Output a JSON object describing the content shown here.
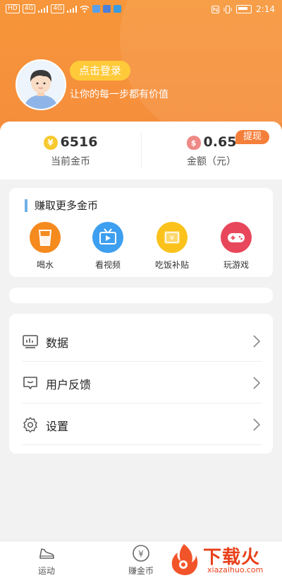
{
  "status_bar": {
    "left_chips": [
      "HD",
      "4G",
      "4G"
    ],
    "time": "2:14"
  },
  "profile": {
    "login_label": "点击登录",
    "slogan": "让你的每一步都有价值"
  },
  "stats": {
    "coins_value": "6516",
    "coins_label": "当前金币",
    "amount_value": "0.65",
    "amount_label": "金额（元）",
    "withdraw_label": "提现",
    "coin_symbol": "¥",
    "bag_symbol": "$"
  },
  "earn": {
    "title": "赚取更多金币",
    "tasks": [
      {
        "label": "喝水",
        "icon": "cup-icon",
        "color": "#f58a1f"
      },
      {
        "label": "看视频",
        "icon": "tv-icon",
        "color": "#3d9ff0"
      },
      {
        "label": "吃饭补贴",
        "icon": "meal-ticket-icon",
        "color": "#fbc21c"
      },
      {
        "label": "玩游戏",
        "icon": "gamepad-icon",
        "color": "#e8475b"
      }
    ]
  },
  "menu": {
    "items": [
      {
        "label": "数据",
        "icon": "chart-icon"
      },
      {
        "label": "用户反馈",
        "icon": "feedback-icon"
      },
      {
        "label": "设置",
        "icon": "gear-icon"
      }
    ]
  },
  "bottom_nav": {
    "items": [
      {
        "label": "运动",
        "icon": "sneaker-icon"
      },
      {
        "label": "赚金币",
        "icon": "yuan-coin-icon"
      }
    ]
  },
  "watermark": {
    "title": "下载火",
    "url": "xiazaihuo.com"
  },
  "colors": {
    "header": "#f7963a",
    "login_button": "#ffca3a",
    "withdraw": "#f47f3a",
    "title_bar": "#6fb0e6",
    "watermark": "#e8401a"
  }
}
